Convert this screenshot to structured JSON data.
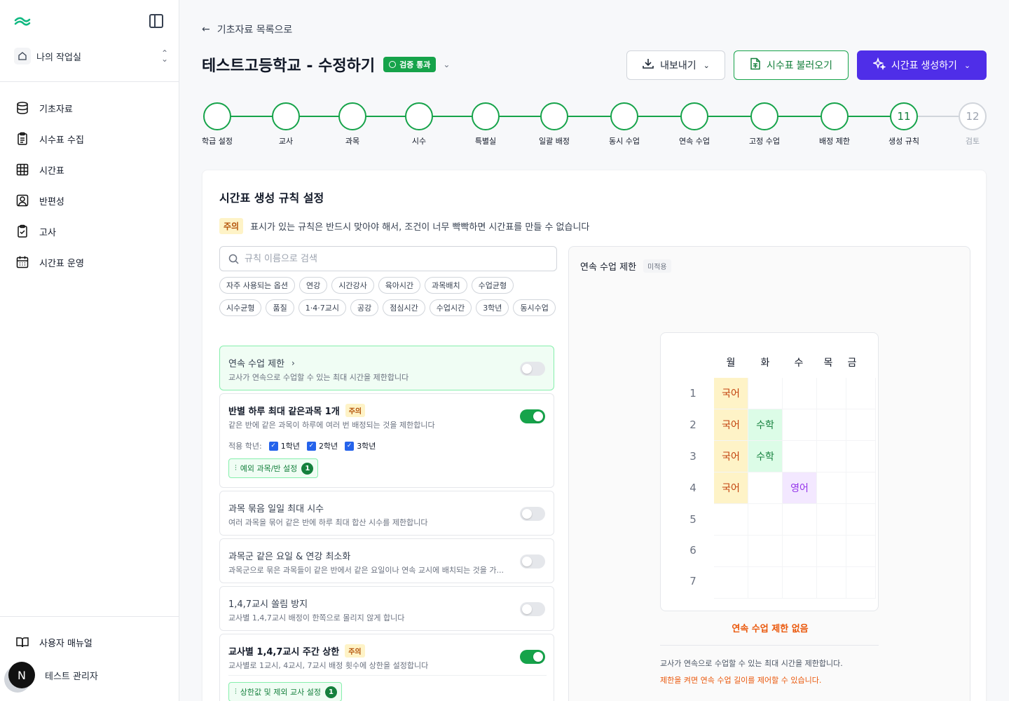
{
  "sidebar": {
    "workspace": "나의 작업실",
    "items": [
      {
        "label": "기초자료",
        "icon": "database-icon"
      },
      {
        "label": "시수표 수집",
        "icon": "clipboard-list-icon"
      },
      {
        "label": "시간표",
        "icon": "grid-icon"
      },
      {
        "label": "반편성",
        "icon": "user-square-icon"
      },
      {
        "label": "고사",
        "icon": "clipboard-check-icon"
      },
      {
        "label": "시간표 운영",
        "icon": "calendar-icon"
      }
    ],
    "manual": "사용자 매뉴얼",
    "user": {
      "initial": "N",
      "name": "테스트 관리자"
    }
  },
  "header": {
    "back": "기초자료 목록으로",
    "title": "테스트고등학교 - 수정하기",
    "badge": "검증 통과",
    "export_label": "내보내기",
    "import_label": "시수표 불러오기",
    "generate_label": "시간표 생성하기"
  },
  "steps": [
    {
      "num": "",
      "label": "학급 설정",
      "done": true
    },
    {
      "num": "",
      "label": "교사",
      "done": true
    },
    {
      "num": "",
      "label": "과목",
      "done": true
    },
    {
      "num": "",
      "label": "시수",
      "done": true
    },
    {
      "num": "",
      "label": "특별실",
      "done": true
    },
    {
      "num": "",
      "label": "일괄 배정",
      "done": true
    },
    {
      "num": "",
      "label": "동시 수업",
      "done": true
    },
    {
      "num": "",
      "label": "연속 수업",
      "done": true
    },
    {
      "num": "",
      "label": "고정 수업",
      "done": true
    },
    {
      "num": "",
      "label": "배정 제한",
      "done": true
    },
    {
      "num": "11",
      "label": "생성 규칙",
      "done": true
    },
    {
      "num": "12",
      "label": "검토",
      "done": false
    }
  ],
  "panel": {
    "title": "시간표 생성 규칙 설정",
    "notice_tag": "주의",
    "notice": "표시가 있는 규칙은 반드시 맞아야 해서, 조건이 너무 빡빡하면 시간표를 만들 수 없습니다",
    "search_placeholder": "규칙 이름으로 검색",
    "chips": [
      "자주 사용되는 옵션",
      "연강",
      "시간강사",
      "육아시간",
      "과목배치",
      "수업균형",
      "시수균형",
      "품질",
      "1·4·7교시",
      "공강",
      "점심시간",
      "수업시간",
      "3학년",
      "동시수업"
    ],
    "rules": [
      {
        "title": "연속 수업 제한",
        "desc": "교사가 연속으로 수업할 수 있는 최대 시간을 제한합니다",
        "on": false,
        "warn": ""
      },
      {
        "title": "반별 하루 최대 같은과목 1개",
        "desc": "같은 반에 같은 과목이 하루에 여러 번 배정되는 것을 제한합니다",
        "on": true,
        "warn": "주의",
        "grades_label": "적용 학년:",
        "grades": [
          "1학년",
          "2학년",
          "3학년"
        ],
        "exception_label": "예외 과목/반 설정",
        "exception_count": "1"
      },
      {
        "title": "과목 묶음 일일 최대 시수",
        "desc": "여러 과목을 묶어 같은 반에 하루 최대 합산 시수를 제한합니다",
        "on": false,
        "warn": ""
      },
      {
        "title": "과목군 같은 요일 & 연강 최소화",
        "desc": "과목군으로 묶은 과목들이 같은 반에서 같은 요일이나 연속 교시에 배치되는 것을 가...",
        "on": false,
        "warn": ""
      },
      {
        "title": "1,4,7교시 쏠림 방지",
        "desc": "교사별 1,4,7교시 배정이 한쪽으로 몰리지 않게 합니다",
        "on": false,
        "warn": ""
      },
      {
        "title": "교사별 1,4,7교시 주간 상한",
        "desc": "교사별로 1교시, 4교시, 7교시 배정 횟수에 상한을 설정합니다",
        "on": true,
        "warn": "주의",
        "exception_label": "상한값 및 제외 교사 설정",
        "exception_count": "1"
      }
    ]
  },
  "preview": {
    "title": "연속 수업 제한",
    "tag": "미적용",
    "days": [
      "월",
      "화",
      "수",
      "목",
      "금"
    ],
    "periods": [
      "1",
      "2",
      "3",
      "4",
      "5",
      "6",
      "7"
    ],
    "cells": [
      {
        "day": 0,
        "period": 0,
        "text": "국어",
        "bg": "#fef3c7",
        "fg": "#c2410c"
      },
      {
        "day": 0,
        "period": 1,
        "text": "국어",
        "bg": "#fef3c7",
        "fg": "#c2410c"
      },
      {
        "day": 1,
        "period": 1,
        "text": "수학",
        "bg": "#dcfce7",
        "fg": "#15803d"
      },
      {
        "day": 0,
        "period": 2,
        "text": "국어",
        "bg": "#fef3c7",
        "fg": "#c2410c"
      },
      {
        "day": 1,
        "period": 2,
        "text": "수학",
        "bg": "#dcfce7",
        "fg": "#15803d"
      },
      {
        "day": 0,
        "period": 3,
        "text": "국어",
        "bg": "#fef3c7",
        "fg": "#c2410c"
      },
      {
        "day": 2,
        "period": 3,
        "text": "영어",
        "bg": "#f3e8ff",
        "fg": "#9333ea"
      }
    ],
    "status": "연속 수업 제한 없음",
    "desc": "교사가 연속으로 수업할 수 있는 최대 시간을 제한합니다.",
    "hint": "제한을 켜면 연속 수업 길이를 제어할 수 있습니다."
  }
}
